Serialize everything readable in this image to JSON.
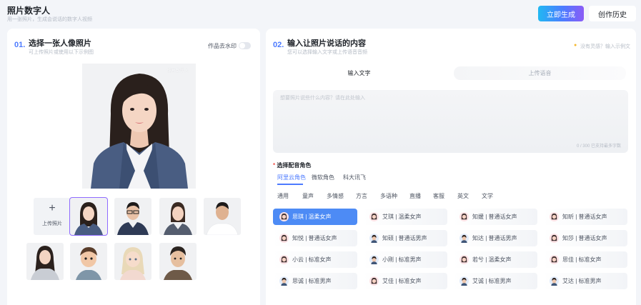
{
  "header": {
    "title": "照片数字人",
    "subtitle": "用一张照片，生成会说话的数字人视频",
    "generate_label": "立即生成",
    "history_label": "创作历史"
  },
  "left_panel": {
    "step_number": "01.",
    "title": "选择一张人像照片",
    "subtitle": "可上传照片或使用以下示例图",
    "watermark_label": "作品去水印",
    "watermark_enabled": false,
    "main_photo_mark": "照片数字人",
    "upload_label": "上传照片",
    "samples": [
      {
        "name": "woman-blazer",
        "selected": true
      },
      {
        "name": "man-glasses-suit",
        "selected": false
      },
      {
        "name": "woman-suit",
        "selected": false
      },
      {
        "name": "man-tshirt",
        "selected": false
      },
      {
        "name": "girl-shirt",
        "selected": false
      },
      {
        "name": "cartoon-boy",
        "selected": false
      },
      {
        "name": "cartoon-girl",
        "selected": false
      },
      {
        "name": "cartoon-man",
        "selected": false
      }
    ]
  },
  "right_panel": {
    "step_number": "02.",
    "title": "输入让照片说话的内容",
    "subtitle": "您可以选择输入文字或上传语音音频",
    "hint": "没有灵感？输入示例文",
    "tabs": [
      "输入文字",
      "上传语音"
    ],
    "text_placeholder": "想要照片说些什么内容？请在此处输入",
    "char_count": "0 / 300 已支持最多字数",
    "voice_title": "选择配音角色",
    "sources": [
      "阿里云角色",
      "微软角色",
      "科大讯飞"
    ],
    "categories": [
      "通用",
      "童声",
      "多情感",
      "方言",
      "多语种",
      "直播",
      "客服",
      "英文",
      "文学"
    ],
    "voices": [
      {
        "label": "思琪 | 温柔女声",
        "gender": "f",
        "selected": true
      },
      {
        "label": "艾琪 | 温柔女声",
        "gender": "f",
        "selected": false
      },
      {
        "label": "知媛 | 普通话女声",
        "gender": "f",
        "selected": false
      },
      {
        "label": "知昕 | 普通话女声",
        "gender": "f",
        "selected": false
      },
      {
        "label": "知悦 | 普通话女声",
        "gender": "f",
        "selected": false
      },
      {
        "label": "知硕 | 普通话男声",
        "gender": "m",
        "selected": false
      },
      {
        "label": "知达 | 普通话男声",
        "gender": "m",
        "selected": false
      },
      {
        "label": "知莎 | 普通话女声",
        "gender": "f",
        "selected": false
      },
      {
        "label": "小云 | 标准女声",
        "gender": "f",
        "selected": false
      },
      {
        "label": "小刚 | 标准男声",
        "gender": "m",
        "selected": false
      },
      {
        "label": "若兮 | 温柔女声",
        "gender": "f",
        "selected": false
      },
      {
        "label": "思佳 | 标准女声",
        "gender": "f",
        "selected": false
      },
      {
        "label": "思诚 | 标准男声",
        "gender": "m",
        "selected": false
      },
      {
        "label": "艾佳 | 标准女声",
        "gender": "f",
        "selected": false
      },
      {
        "label": "艾诚 | 标准男声",
        "gender": "m",
        "selected": false
      },
      {
        "label": "艾达 | 标准男声",
        "gender": "m",
        "selected": false
      }
    ]
  },
  "colors": {
    "accent": "#4d7bff",
    "selected_voice": "#4d8bf5",
    "required": "#f2534a",
    "page_bg": "#f3f5f9"
  }
}
